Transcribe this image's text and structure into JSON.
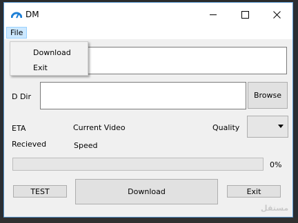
{
  "window": {
    "title": "DM",
    "icon": "speedometer-icon",
    "accent": "#5b9bd5"
  },
  "titlebar_buttons": [
    "minimize-icon",
    "maximize-icon",
    "close-icon"
  ],
  "menu": {
    "file_label": "File",
    "items": [
      "Download",
      "Exit"
    ]
  },
  "form": {
    "url_value": "",
    "dir_label": "D Dir",
    "dir_value": "",
    "browse_label": "Browse",
    "eta_label": "ETA",
    "current_video_label": "Current Video",
    "quality_label": "Quality",
    "quality_value": "",
    "received_label": "Recieved",
    "speed_label": "Speed"
  },
  "progress": {
    "value": 0,
    "text": "0%",
    "fill_color": "#06b025"
  },
  "buttons": {
    "test": "TEST",
    "download": "Download",
    "exit": "Exit"
  },
  "watermark": "مستقل"
}
